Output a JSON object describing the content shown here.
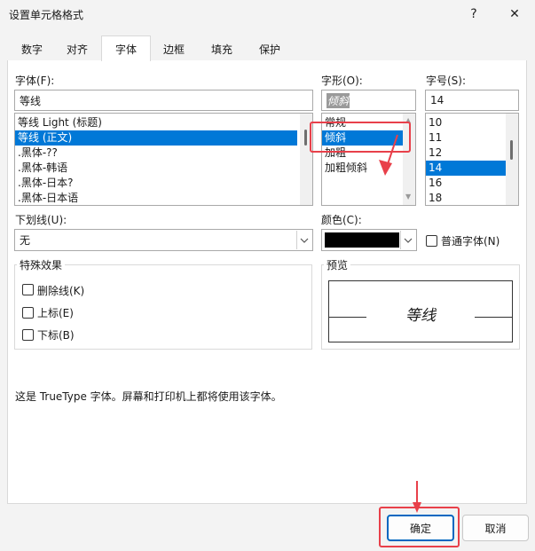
{
  "window": {
    "title": "设置单元格格式",
    "help_label": "?",
    "close_label": "✕"
  },
  "tabs": [
    {
      "label": "数字"
    },
    {
      "label": "对齐"
    },
    {
      "label": "字体",
      "active": true
    },
    {
      "label": "边框"
    },
    {
      "label": "填充"
    },
    {
      "label": "保护"
    }
  ],
  "font": {
    "label": "字体(F):",
    "value": "等线",
    "items": [
      "等线 Light (标题)",
      "等线 (正文)",
      ".黑体-??",
      ".黑体-韩语",
      ".黑体-日本?",
      ".黑体-日本语"
    ],
    "selected_index": 1
  },
  "style": {
    "label": "字形(O):",
    "value": "倾斜",
    "items": [
      "常规",
      "倾斜",
      "加粗",
      "加粗倾斜"
    ],
    "selected_index": 1
  },
  "size": {
    "label": "字号(S):",
    "value": "14",
    "items": [
      "10",
      "11",
      "12",
      "14",
      "16",
      "18"
    ],
    "selected_index": 3
  },
  "underline": {
    "label": "下划线(U):",
    "value": "无"
  },
  "color": {
    "label": "颜色(C):",
    "value_hex": "#000000",
    "normal_font_label": "普通字体(N)"
  },
  "effects": {
    "title": "特殊效果",
    "strikethrough": "删除线(K)",
    "superscript": "上标(E)",
    "subscript": "下标(B)"
  },
  "preview": {
    "title": "预览",
    "sample": "等线"
  },
  "info_text": "这是 TrueType 字体。屏幕和打印机上都将使用该字体。",
  "buttons": {
    "ok": "确定",
    "cancel": "取消"
  },
  "colors": {
    "selection": "#0078d7",
    "highlight_annotation": "#e8404a",
    "primary_border": "#0067c0"
  }
}
